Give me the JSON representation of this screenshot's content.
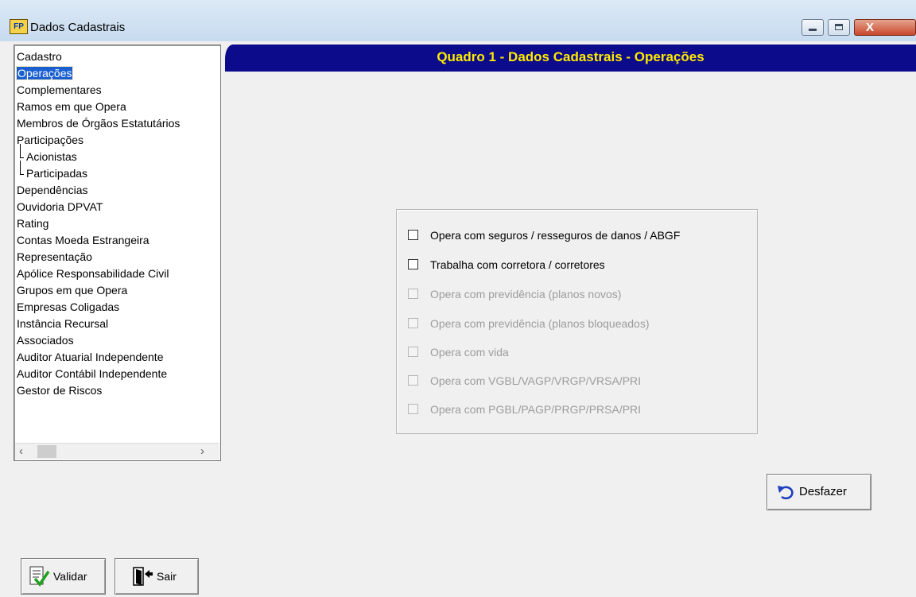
{
  "window": {
    "title": "Dados Cadastrais",
    "app_icon_text": "FP",
    "controls": [
      "minimize-icon",
      "maximize-icon",
      "close-icon"
    ]
  },
  "tree": {
    "items": [
      {
        "label": "Cadastro"
      },
      {
        "label": "Operações",
        "selected": true
      },
      {
        "label": "Complementares"
      },
      {
        "label": "Ramos em que Opera"
      },
      {
        "label": "Membros de Órgãos Estatutários"
      },
      {
        "label": "Participações"
      },
      {
        "label": "Acionistas",
        "child": true
      },
      {
        "label": "Participadas",
        "child": true
      },
      {
        "label": "Dependências"
      },
      {
        "label": "Ouvidoria DPVAT"
      },
      {
        "label": "Rating"
      },
      {
        "label": "Contas Moeda Estrangeira"
      },
      {
        "label": "Representação"
      },
      {
        "label": "Apólice Responsabilidade Civil"
      },
      {
        "label": "Grupos em que Opera"
      },
      {
        "label": "Empresas Coligadas"
      },
      {
        "label": "Instância Recursal"
      },
      {
        "label": "Associados"
      },
      {
        "label": "Auditor Atuarial Independente"
      },
      {
        "label": "Auditor Contábil Independente"
      },
      {
        "label": "Gestor de Riscos"
      }
    ]
  },
  "header": {
    "title": "Quadro 1 - Dados Cadastrais - Operações"
  },
  "options": [
    {
      "label": "Opera com seguros / resseguros de danos / ABGF",
      "checked": false,
      "enabled": true
    },
    {
      "label": "Trabalha com corretora / corretores",
      "checked": false,
      "enabled": true
    },
    {
      "label": "Opera com previdência (planos novos)",
      "checked": false,
      "enabled": false
    },
    {
      "label": "Opera com previdência (planos bloqueados)",
      "checked": false,
      "enabled": false
    },
    {
      "label": "Opera com vida",
      "checked": false,
      "enabled": false
    },
    {
      "label": "Opera com VGBL/VAGP/VRGP/VRSA/PRI",
      "checked": false,
      "enabled": false
    },
    {
      "label": "Opera com PGBL/PAGP/PRGP/PRSA/PRI",
      "checked": false,
      "enabled": false
    }
  ],
  "buttons": {
    "undo": "Desfazer",
    "validate": "Validar",
    "exit": "Sair"
  },
  "colors": {
    "header_bg": "#0b0b8b",
    "header_text": "#ffea00",
    "selection": "#1a5fd0"
  }
}
